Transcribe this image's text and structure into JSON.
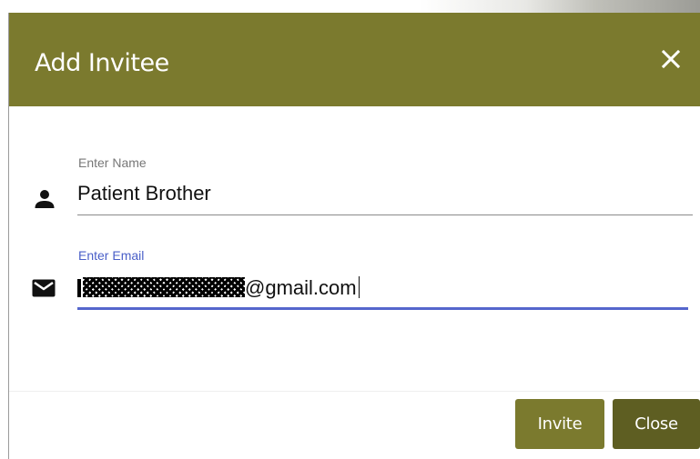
{
  "dialog": {
    "title": "Add Invitee",
    "close_icon": "close-icon"
  },
  "form": {
    "name_field": {
      "label": "Enter Name",
      "value": "Patient Brother",
      "icon": "person-icon"
    },
    "email_field": {
      "label": "Enter Email",
      "value_visible_suffix": "gmail.com",
      "value_at": "@",
      "icon": "mail-icon"
    }
  },
  "footer": {
    "invite_label": "Invite",
    "close_label": "Close"
  },
  "colors": {
    "header": "#7b7a2e",
    "invite_button": "#7b7a2e",
    "close_button": "#5e5e22",
    "active_underline": "#5566cc",
    "active_label": "#4a5fc8",
    "inactive_label": "#777777"
  }
}
